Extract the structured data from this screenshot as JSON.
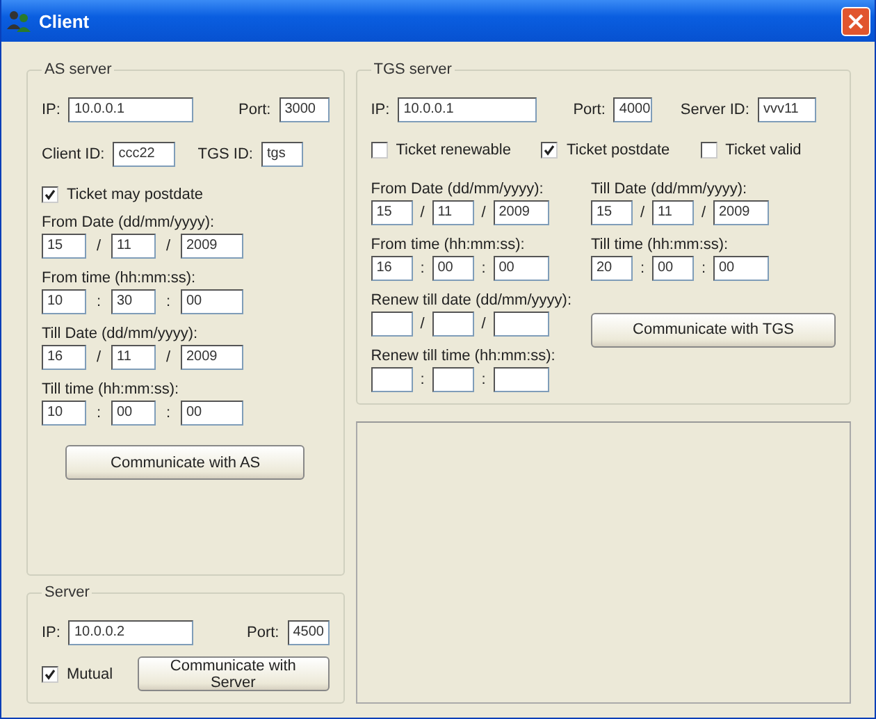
{
  "window": {
    "title": "Client"
  },
  "as_server": {
    "title": "AS server",
    "ip_label": "IP:",
    "ip": "10.0.0.1",
    "port_label": "Port:",
    "port": "3000",
    "client_id_label": "Client ID:",
    "client_id": "ccc22",
    "tgs_id_label": "TGS ID:",
    "tgs_id": "tgs",
    "postdate": {
      "label": "Ticket may postdate",
      "checked": true
    },
    "groups": [
      {
        "label": "From Date (dd/mm/yyyy):",
        "separator": "/",
        "fields": [
          {
            "value": "15"
          },
          {
            "value": "11"
          },
          {
            "value": "2009"
          }
        ]
      },
      {
        "label": "From time (hh:mm:ss):",
        "separator": ":",
        "fields": [
          {
            "value": "10"
          },
          {
            "value": "30"
          },
          {
            "value": "00"
          }
        ]
      },
      {
        "label": "Till Date (dd/mm/yyyy):",
        "separator": "/",
        "fields": [
          {
            "value": "16"
          },
          {
            "value": "11"
          },
          {
            "value": "2009"
          }
        ]
      },
      {
        "label": "Till time (hh:mm:ss):",
        "separator": ":",
        "fields": [
          {
            "value": "10"
          },
          {
            "value": "00"
          },
          {
            "value": "00"
          }
        ]
      }
    ],
    "button": "Communicate with AS"
  },
  "server": {
    "title": "Server",
    "ip_label": "IP:",
    "ip": "10.0.0.2",
    "port_label": "Port:",
    "port": "4500",
    "mutual": {
      "label": "Mutual",
      "checked": true
    },
    "button": "Communicate with Server"
  },
  "tgs_server": {
    "title": "TGS server",
    "ip_label": "IP:",
    "ip": "10.0.0.1",
    "port_label": "Port:",
    "port": "4000",
    "server_id_label": "Server ID:",
    "server_id": "vvv11",
    "options": [
      {
        "label": "Ticket renewable",
        "checked": false
      },
      {
        "label": "Ticket postdate",
        "checked": true
      },
      {
        "label": "Ticket valid",
        "checked": false
      }
    ],
    "groups": [
      {
        "label": "From Date (dd/mm/yyyy):",
        "separator": "/",
        "fields": [
          {
            "value": "15"
          },
          {
            "value": "11"
          },
          {
            "value": "2009"
          }
        ]
      },
      {
        "label": "Till Date (dd/mm/yyyy):",
        "separator": "/",
        "fields": [
          {
            "value": "15"
          },
          {
            "value": "11"
          },
          {
            "value": "2009"
          }
        ]
      },
      {
        "label": "From time (hh:mm:ss):",
        "separator": ":",
        "fields": [
          {
            "value": "16"
          },
          {
            "value": "00"
          },
          {
            "value": "00"
          }
        ]
      },
      {
        "label": "Till time (hh:mm:ss):",
        "separator": ":",
        "fields": [
          {
            "value": "20"
          },
          {
            "value": "00"
          },
          {
            "value": "00"
          }
        ]
      },
      {
        "label": "Renew till date (dd/mm/yyyy):",
        "separator": "/"
      },
      {
        "label": "Renew till time (hh:mm:ss):",
        "separator": ":"
      }
    ],
    "button": "Communicate with TGS"
  }
}
